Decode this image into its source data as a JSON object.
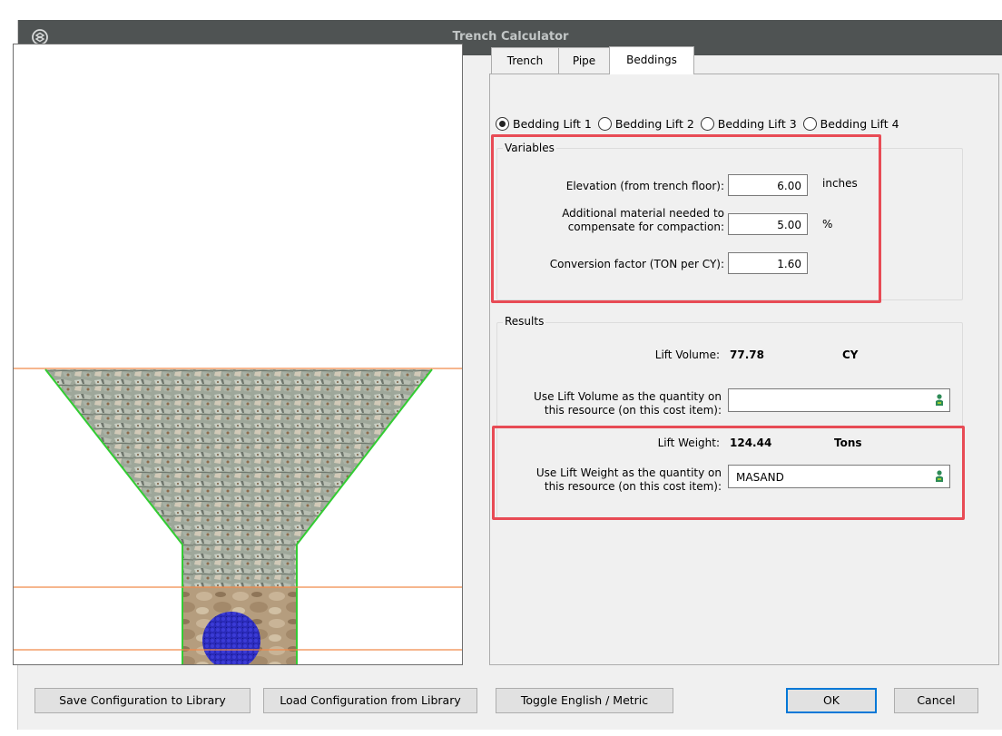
{
  "window": {
    "title": "Trench Calculator",
    "app_icon": "app-logo-icon"
  },
  "tabs": [
    {
      "label": "Trench",
      "active": false
    },
    {
      "label": "Pipe",
      "active": false
    },
    {
      "label": "Beddings",
      "active": true
    }
  ],
  "bedding_lifts": [
    {
      "label": "Bedding Lift 1",
      "selected": true
    },
    {
      "label": "Bedding Lift 2",
      "selected": false
    },
    {
      "label": "Bedding Lift 3",
      "selected": false
    },
    {
      "label": "Bedding Lift 4",
      "selected": false
    }
  ],
  "variables": {
    "group_label": "Variables",
    "elevation_label": "Elevation (from trench floor):",
    "elevation_value": "6.00",
    "elevation_unit": "inches",
    "additional_label_line1": "Additional material needed to",
    "additional_label_line2": "compensate for compaction:",
    "additional_value": "5.00",
    "additional_unit": "%",
    "conversion_label": "Conversion factor (TON per CY):",
    "conversion_value": "1.60"
  },
  "results": {
    "group_label": "Results",
    "lift_volume_label": "Lift Volume:",
    "lift_volume_value": "77.78",
    "lift_volume_unit": "CY",
    "use_volume_label_line1": "Use Lift Volume as the quantity on",
    "use_volume_label_line2": "this resource (on this cost item):",
    "use_volume_value": "",
    "lift_weight_label": "Lift Weight:",
    "lift_weight_value": "124.44",
    "lift_weight_unit": "Tons",
    "use_weight_label_line1": "Use Lift Weight as the quantity on",
    "use_weight_label_line2": "this resource (on this cost item):",
    "use_weight_value": "MASAND"
  },
  "buttons": {
    "save_config": "Save Configuration to Library",
    "load_config": "Load Configuration from Library",
    "toggle_units": "Toggle English / Metric",
    "ok": "OK",
    "cancel": "Cancel"
  },
  "colors": {
    "titlebar": "#4f5353",
    "highlight": "#e84b55",
    "trench_outline": "#33cc33",
    "level_line": "#f08a4b",
    "pipe": "#1a1aa8"
  }
}
